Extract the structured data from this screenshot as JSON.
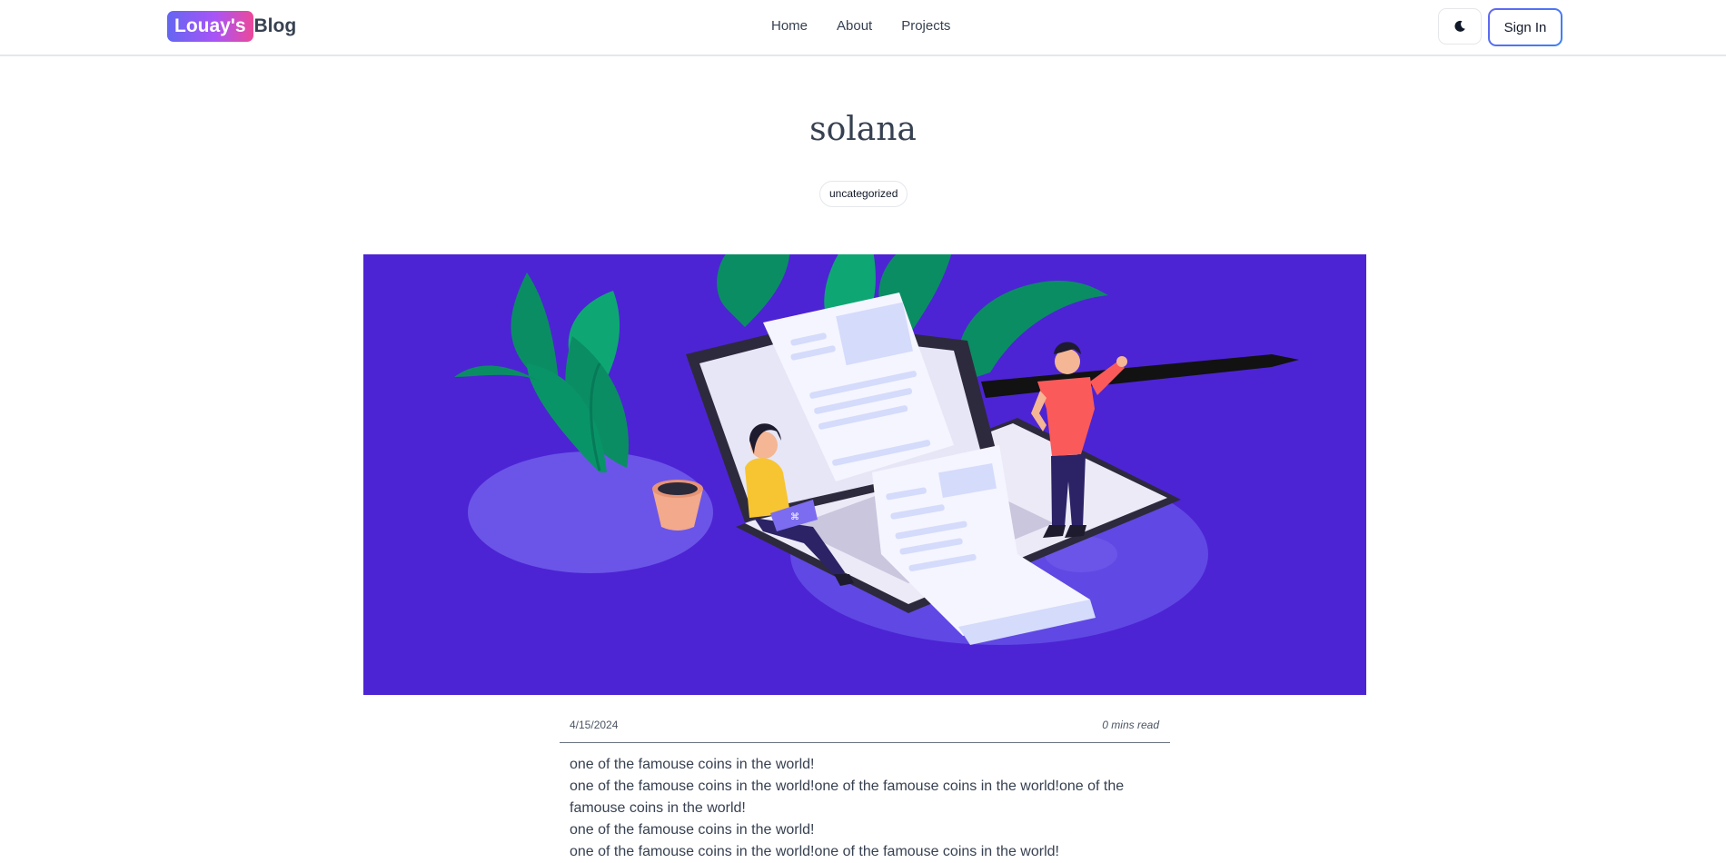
{
  "header": {
    "logo_badge": "Louay's",
    "logo_text": "Blog",
    "nav": [
      "Home",
      "About",
      "Projects"
    ],
    "theme_toggle_icon": "moon-icon",
    "signin_label": "Sign In"
  },
  "post": {
    "title": "solana",
    "category": "uncategorized",
    "hero_image": "illustration-writing-blog-post",
    "date": "4/15/2024",
    "read_time": "0 mins read",
    "content": [
      "one of the famouse coins in the world!",
      "one of the famouse coins in the world!one of the famouse coins in the world!one of the famouse coins in the world!",
      "one of the famouse coins in the world!",
      "one of the famouse coins in the world!one of the famouse coins in the world!"
    ]
  },
  "colors": {
    "hero_bg": "#4c24d4",
    "accent_start": "#6366f1",
    "accent_end": "#ec4899"
  }
}
